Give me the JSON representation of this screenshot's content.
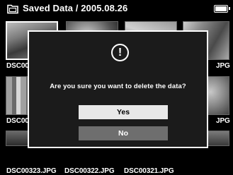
{
  "header": {
    "title": "Saved Data / 2005.08.26",
    "folder_icon": "folder-icon",
    "battery_icon": "battery-full-icon"
  },
  "thumbnails": [
    {
      "label": "DSC00",
      "selected": true
    },
    {
      "label": "",
      "selected": false
    },
    {
      "label": "",
      "selected": false
    },
    {
      "label": "JPG",
      "selected": false
    },
    {
      "label": "DSC00",
      "selected": false
    },
    {
      "label": "JPG",
      "selected": false
    },
    {
      "label": "DSC00323.JPG",
      "selected": false
    },
    {
      "label": "DSC00322.JPG",
      "selected": false
    },
    {
      "label": "DSC00321.JPG",
      "selected": false
    }
  ],
  "dialog": {
    "icon": "alert-icon",
    "icon_glyph": "!",
    "message": "Are you sure you want to delete the data?",
    "yes_label": "Yes",
    "no_label": "No",
    "focused": "Yes"
  }
}
